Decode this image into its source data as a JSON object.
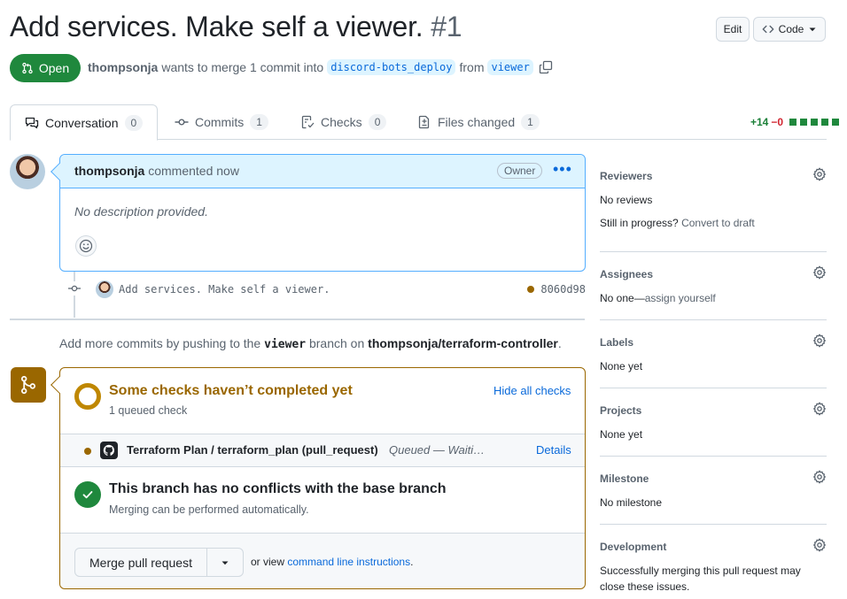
{
  "header": {
    "title": "Add services. Make self a viewer.",
    "number": "#1",
    "edit_label": "Edit",
    "code_label": "Code",
    "state_label": "Open",
    "author": "thompsonja",
    "merge_text": "wants to merge 1 commit into",
    "base_branch": "discord-bots_deploy",
    "from_text": "from",
    "head_branch": "viewer"
  },
  "tabs": [
    {
      "label": "Conversation",
      "count": "0"
    },
    {
      "label": "Commits",
      "count": "1"
    },
    {
      "label": "Checks",
      "count": "0"
    },
    {
      "label": "Files changed",
      "count": "1"
    }
  ],
  "diffstat": {
    "additions": "+14",
    "deletions": "−0"
  },
  "comment": {
    "author": "thompsonja",
    "action": "commented now",
    "badge": "Owner",
    "body": "No description provided."
  },
  "commit": {
    "message": "Add services. Make self a viewer.",
    "sha": "8060d98",
    "status_color": "#9a6700"
  },
  "push_hint": {
    "prefix": "Add more commits by pushing to the",
    "branch": "viewer",
    "middle": "branch on",
    "repo": "thompsonja/terraform-controller",
    "suffix": "."
  },
  "checks": {
    "title": "Some checks haven’t completed yet",
    "subtitle": "1 queued check",
    "toggle_label": "Hide all checks",
    "items": [
      {
        "name": "Terraform Plan / terraform_plan (pull_request)",
        "status": "Queued — Waiti…",
        "details_label": "Details"
      }
    ]
  },
  "conflicts": {
    "title": "This branch has no conflicts with the base branch",
    "subtitle": "Merging can be performed automatically."
  },
  "merge": {
    "button_label": "Merge pull request",
    "or_view": "or view",
    "cli_link": "command line instructions",
    "period": "."
  },
  "sidebar": {
    "reviewers": {
      "heading": "Reviewers",
      "value": "No reviews",
      "progress": "Still in progress?",
      "draft_link": "Convert to draft"
    },
    "assignees": {
      "heading": "Assignees",
      "value": "No one—",
      "assign_link": "assign yourself"
    },
    "labels": {
      "heading": "Labels",
      "value": "None yet"
    },
    "projects": {
      "heading": "Projects",
      "value": "None yet"
    },
    "milestone": {
      "heading": "Milestone",
      "value": "No milestone"
    },
    "development": {
      "heading": "Development",
      "line1": "Successfully merging this pull request may",
      "line2": "close these issues."
    }
  },
  "colors": {
    "open": "#1f883d",
    "pending": "#9a6700",
    "link": "#0969da"
  }
}
